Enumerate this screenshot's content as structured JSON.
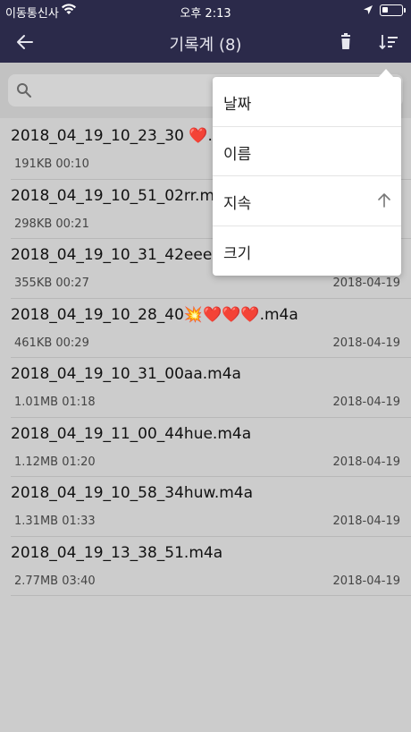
{
  "status_bar": {
    "carrier": "이동통신사",
    "time": "오후 2:13"
  },
  "nav": {
    "title": "기록계 (8)"
  },
  "search": {
    "placeholder": ""
  },
  "recordings": [
    {
      "name": "2018_04_19_10_23_30 ❤️.m4a",
      "meta": "191KB 00:10",
      "date": ""
    },
    {
      "name": "2018_04_19_10_51_02rr.m4a",
      "meta": "298KB 00:21",
      "date": ""
    },
    {
      "name": "2018_04_19_10_31_42eee.m4a",
      "meta": "355KB 00:27",
      "date": "2018-04-19"
    },
    {
      "name": "2018_04_19_10_28_40💥❤️❤️❤️.m4a",
      "meta": "461KB 00:29",
      "date": "2018-04-19"
    },
    {
      "name": "2018_04_19_10_31_00aa.m4a",
      "meta": "1.01MB 01:18",
      "date": "2018-04-19"
    },
    {
      "name": "2018_04_19_11_00_44hue.m4a",
      "meta": "1.12MB 01:20",
      "date": "2018-04-19"
    },
    {
      "name": "2018_04_19_10_58_34huw.m4a",
      "meta": "1.31MB 01:33",
      "date": "2018-04-19"
    },
    {
      "name": "2018_04_19_13_38_51.m4a",
      "meta": "2.77MB 03:40",
      "date": "2018-04-19"
    }
  ],
  "sort_menu": {
    "items": [
      {
        "label": "날짜"
      },
      {
        "label": "이름"
      },
      {
        "label": "지속"
      },
      {
        "label": "크기"
      }
    ]
  },
  "colors": {
    "nav_background": "#2b2a4a",
    "overlay_background": "#cccccc"
  }
}
